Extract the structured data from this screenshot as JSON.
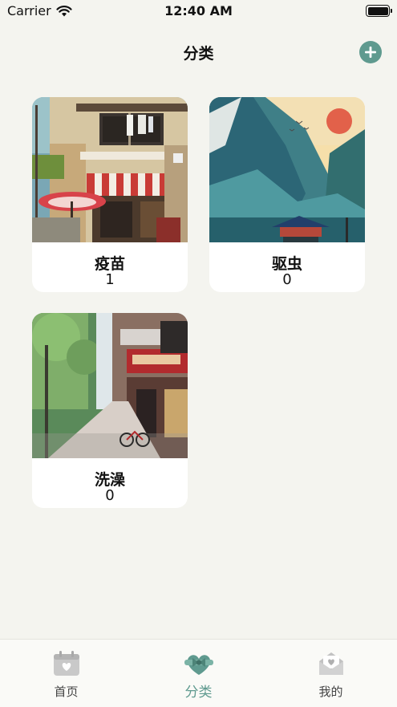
{
  "status_bar": {
    "carrier": "Carrier",
    "time": "12:40 AM"
  },
  "nav": {
    "title": "分类",
    "add_icon": "plus-icon"
  },
  "categories": [
    {
      "name": "疫苗",
      "count": "1",
      "image": "street-shop-illustration"
    },
    {
      "name": "驱虫",
      "count": "0",
      "image": "mountain-temple-illustration"
    },
    {
      "name": "洗澡",
      "count": "0",
      "image": "city-street-illustration"
    }
  ],
  "tabs": [
    {
      "label": "首页",
      "icon": "calendar-heart-icon",
      "active": false
    },
    {
      "label": "分类",
      "icon": "heart-bow-icon",
      "active": true
    },
    {
      "label": "我的",
      "icon": "envelope-heart-icon",
      "active": false
    }
  ],
  "colors": {
    "accent": "#5f9a8f",
    "background": "#f4f4ef",
    "card": "#ffffff"
  }
}
